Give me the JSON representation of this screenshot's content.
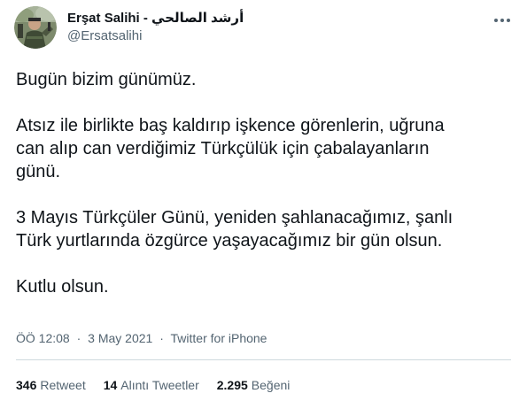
{
  "author": {
    "display_name": "Erşat Salihi - أرشد الصالحي",
    "handle": "@Ersatsalihi",
    "avatar_icon": "profile-photo"
  },
  "tweet": {
    "paragraphs": [
      "Bugün bizim günümüz.",
      "Atsız ile birlikte baş kaldırıp işkence görenlerin, uğruna\ncan alıp can verdiğimiz Türkçülük için çabalayanların\ngünü.",
      "3 Mayıs Türkçüler Günü, yeniden şahlanacağımız, şanlı\nTürk yurtlarında özgürce yaşayacağımız bir gün olsun.",
      "Kutlu olsun."
    ],
    "time": "ÖÖ 12:08",
    "date": "3 May 2021",
    "separator": "·",
    "source": "Twitter for iPhone"
  },
  "stats": {
    "retweets_count": "346",
    "retweets_label": "Retweet",
    "quotes_count": "14",
    "quotes_label": "Alıntı Tweetler",
    "likes_count": "2.295",
    "likes_label": "Beğeni"
  },
  "menu_icon": "more-icon",
  "colors": {
    "text": "#0f1419",
    "secondary": "#536471",
    "divider": "#cfd9de"
  }
}
